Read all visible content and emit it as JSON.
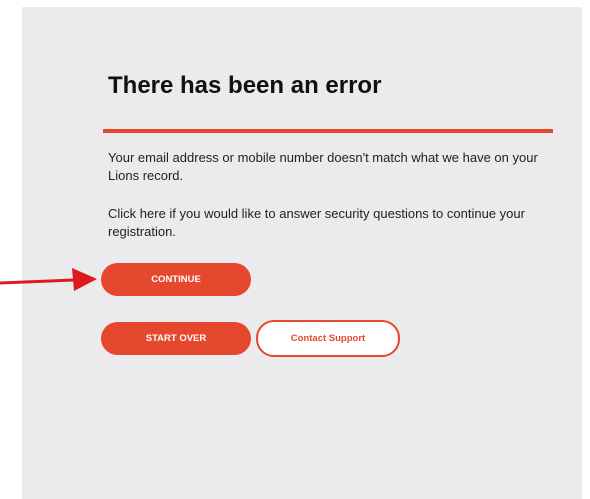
{
  "error": {
    "title": "There has been an error",
    "message": "Your email address or mobile number doesn't match what we have on your Lions record.",
    "instruction": "Click here if you would like to answer security questions to continue your registration."
  },
  "buttons": {
    "continue_label": "CONTINUE",
    "start_over_label": "START OVER",
    "contact_support_label": "Contact Support"
  },
  "annotation": {
    "arrow_icon": "arrow-right-icon",
    "arrow_color": "#e0191f"
  },
  "colors": {
    "accent": "#e5472f",
    "panel_background": "#ebebed"
  }
}
